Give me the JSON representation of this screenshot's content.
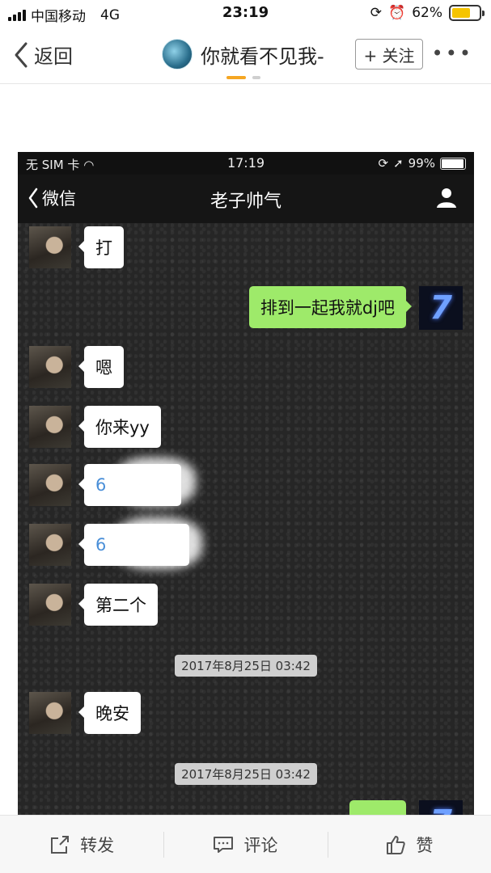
{
  "status": {
    "carrier": "中国移动",
    "network": "4G",
    "time": "23:19",
    "battery": "62%",
    "battery_level": 0.62
  },
  "header": {
    "back_label": "返回",
    "author": "你就看不见我-",
    "follow_label": "+ 关注",
    "more_label": "•••"
  },
  "screenshot": {
    "status": {
      "carrier": "无 SIM 卡",
      "time": "17:19",
      "battery": "99%"
    },
    "nav": {
      "back_label": "微信",
      "title": "老子帅气"
    },
    "messages": [
      {
        "side": "left",
        "text": "打"
      },
      {
        "side": "right",
        "text": "排到一起我就dj吧",
        "avatar_text": "7"
      },
      {
        "side": "left",
        "text": "嗯"
      },
      {
        "side": "left",
        "text": "你来yy"
      },
      {
        "side": "left",
        "text": "6",
        "blurred": true
      },
      {
        "side": "left",
        "text": "6",
        "blurred": true
      },
      {
        "side": "left",
        "text": "第二个"
      },
      {
        "type": "timestamp",
        "text": "2017年8月25日 03:42"
      },
      {
        "side": "left",
        "text": "晚安"
      },
      {
        "type": "timestamp",
        "text": "2017年8月25日 03:42"
      }
    ]
  },
  "toolbar": {
    "share_label": "转发",
    "comment_label": "评论",
    "like_label": "赞"
  }
}
